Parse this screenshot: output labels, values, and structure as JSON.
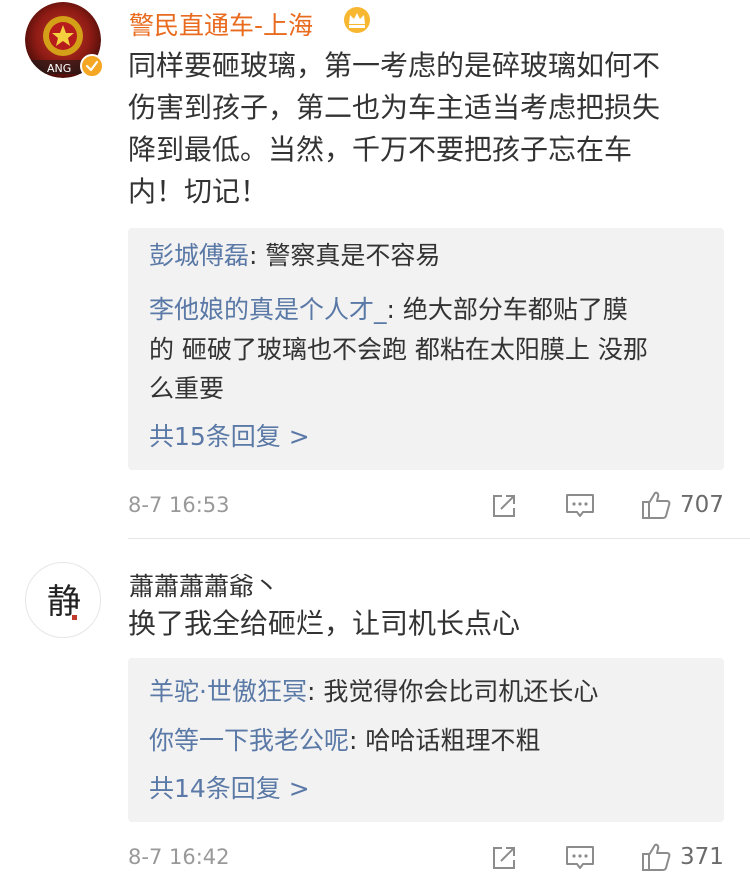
{
  "comments": [
    {
      "username": "警民直通车-上海",
      "avatar_text": "ANG",
      "content_lines": [
        "同样要砸玻璃，第一考虑的是碎玻璃如何不",
        "伤害到孩子，第二也为车主适当考虑把损失",
        "降到最低。当然，千万不要把孩子忘在车",
        "内！切记！"
      ],
      "replies": [
        {
          "name": "彭城傅磊",
          "text_lines": [
            "警察真是不容易"
          ]
        },
        {
          "name": "李他娘的真是个人才_",
          "text_lines": [
            "绝大部分车都贴了膜",
            "的 砸破了玻璃也不会跑 都粘在太阳膜上 没那",
            "么重要"
          ]
        }
      ],
      "more_replies": "共15条回复 >",
      "timestamp": "8-7 16:53",
      "likes": "707"
    },
    {
      "username": "蕭蕭蕭蕭爺丶",
      "avatar_text": "静",
      "content_lines": [
        "换了我全给砸烂，让司机长点心"
      ],
      "replies": [
        {
          "name": "羊驼·世傲狂冥",
          "text_lines": [
            "我觉得你会比司机还长心"
          ]
        },
        {
          "name": "你等一下我老公呢",
          "text_lines": [
            "哈哈话粗理不粗"
          ]
        }
      ],
      "more_replies": "共14条回复 >",
      "timestamp": "8-7 16:42",
      "likes": "371"
    }
  ],
  "colors": {
    "username": "#e86b1f",
    "link": "#5a79a6",
    "reply_bg": "#f2f2f2",
    "verified": "#f5a623"
  },
  "icons": [
    "police-badge-avatar",
    "verified-icon",
    "crown-icon",
    "calligraphy-avatar",
    "share-icon",
    "comment-icon",
    "like-icon"
  ]
}
